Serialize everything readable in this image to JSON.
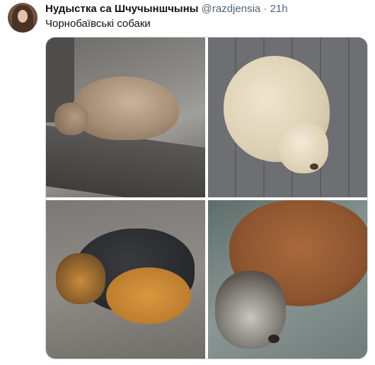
{
  "tweet": {
    "author_name": "Нудыстка са Шчучыншчыны",
    "author_handle": "@razdjensia",
    "separator": "·",
    "time": "21h",
    "text": "Чорнобаївські собаки"
  },
  "media": {
    "photos": [
      {
        "subject": "fat-dog-on-sidewalk"
      },
      {
        "subject": "fat-white-dog-on-pavement"
      },
      {
        "subject": "fat-black-tan-dog-on-cobblestones"
      },
      {
        "subject": "fat-brown-dog-lying"
      }
    ]
  }
}
